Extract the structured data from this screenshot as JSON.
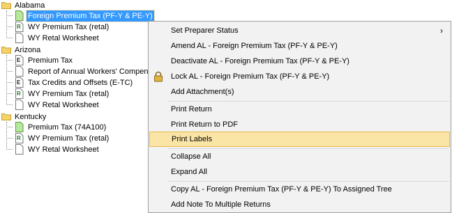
{
  "tree": {
    "groups": [
      {
        "name": "Alabama",
        "items": [
          {
            "label": "Foreign Premium Tax (PF-Y & PE-Y)",
            "icon": "green-doc-icon",
            "selected": true
          },
          {
            "label": "WY Premium Tax (retal)",
            "icon": "r-doc-icon"
          },
          {
            "label": "WY Retal Worksheet",
            "icon": "doc-icon"
          }
        ]
      },
      {
        "name": "Arizona",
        "items": [
          {
            "label": "Premium Tax",
            "icon": "e-doc-icon"
          },
          {
            "label": "Report of Annual Workers' Compen",
            "icon": "doc-icon"
          },
          {
            "label": "Tax Credits and Offsets (E-TC)",
            "icon": "e-doc-icon"
          },
          {
            "label": "WY Premium Tax (retal)",
            "icon": "r-doc-icon"
          },
          {
            "label": "WY Retal Worksheet",
            "icon": "doc-icon"
          }
        ]
      },
      {
        "name": "Kentucky",
        "items": [
          {
            "label": "Premium Tax (74A100)",
            "icon": "green-doc-icon"
          },
          {
            "label": "WY Premium Tax (retal)",
            "icon": "r-doc-icon"
          },
          {
            "label": "WY Retal Worksheet",
            "icon": "doc-icon"
          }
        ]
      }
    ]
  },
  "menu": {
    "items": [
      {
        "label": "Set Preparer Status",
        "submenu": true
      },
      {
        "label": "Amend AL - Foreign Premium Tax (PF-Y & PE-Y)"
      },
      {
        "label": "Deactivate AL - Foreign Premium Tax (PF-Y & PE-Y)"
      },
      {
        "label": "Lock AL - Foreign Premium Tax (PF-Y & PE-Y)",
        "icon": "lock-icon"
      },
      {
        "label": "Add Attachment(s)"
      },
      {
        "label": "Print Return"
      },
      {
        "label": "Print Return to PDF"
      },
      {
        "label": "Print Labels",
        "hover": true
      },
      {
        "label": "Collapse All"
      },
      {
        "label": "Expand All"
      },
      {
        "label": "Copy AL - Foreign Premium Tax (PF-Y & PE-Y) To Assigned Tree"
      },
      {
        "label": "Add Note To Multiple Returns"
      }
    ],
    "submenu_arrow": "›"
  }
}
